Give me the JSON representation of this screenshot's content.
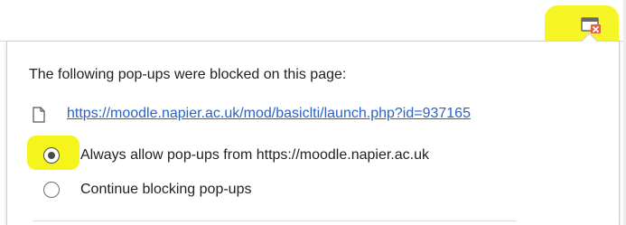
{
  "popup_blocked_bubble": {
    "heading": "The following pop-ups were blocked on this page:",
    "blocked_urls": [
      "https://moodle.napier.ac.uk/mod/basiclti/launch.php?id=937165"
    ],
    "options": [
      {
        "label": "Always allow pop-ups from https://moodle.napier.ac.uk",
        "selected": true
      },
      {
        "label": "Continue blocking pop-ups",
        "selected": false
      }
    ]
  },
  "toolbar": {
    "popup_blocked_icon": "popup-blocked-icon"
  },
  "colors": {
    "highlight": "#f5f51b",
    "link": "#2a63c7",
    "blocked_badge": "#e8613a"
  }
}
